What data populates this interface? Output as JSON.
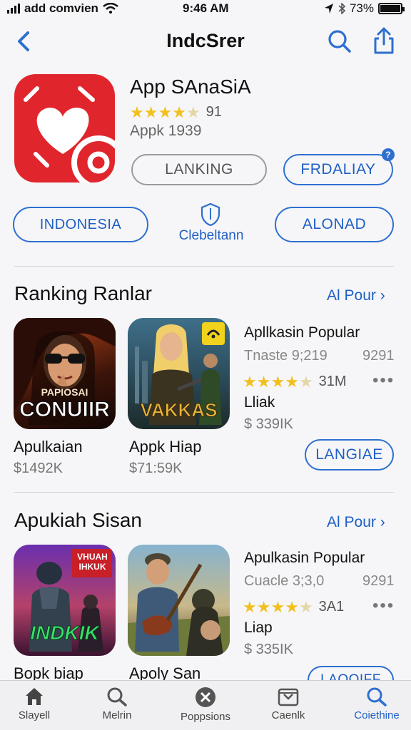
{
  "status_bar": {
    "carrier": "add comvien",
    "time": "9:46 AM",
    "battery": "73%"
  },
  "nav": {
    "title": "IndcSrer"
  },
  "app": {
    "name": "App SAnaSiA",
    "rating_count": "91",
    "rating_stars": 3.5,
    "subtitle": "Appk 1939",
    "buttons": {
      "left": "LANKING",
      "right": "FRDALIAY"
    },
    "badge": "?"
  },
  "row2": {
    "left": "INDONESIA",
    "middle": "Clebeltann",
    "right": "ALONAD"
  },
  "section1": {
    "title": "Ranking Ranlar",
    "see_all": "Al Pour",
    "tiles": [
      {
        "art_top": "PAPIOSAI",
        "art_bottom": "CONUIIR",
        "title": "Apulkaian",
        "price": "$1492K"
      },
      {
        "art_top": "",
        "art_bottom": "VAKKAS",
        "title": "Appk Hiap",
        "price": "$71:59K"
      }
    ],
    "info": {
      "title": "Apllkasin Popular",
      "sub": "Tnaste 9;219",
      "size": "9291",
      "stars": 4.5,
      "count": "31M",
      "name": "Lliak",
      "price": "$ 339IK",
      "button": "LANGIAE"
    }
  },
  "section2": {
    "title": "Apukiah Sisan",
    "see_all": "Al Pour",
    "tiles": [
      {
        "art_top": "VHUAH IHKUK",
        "art_bottom": "INDKIK",
        "title": "Bopk biap",
        "price": ""
      },
      {
        "art_top": "",
        "art_bottom": "",
        "title": "Apoly San",
        "price": ""
      }
    ],
    "info": {
      "title": "Apulkasin Popular",
      "sub": "Cuacle 3;3,0",
      "size": "9291",
      "stars": 4.5,
      "count": "3A1",
      "name": "Liap",
      "price": "$ 335IK",
      "button": "LAQQIFF"
    }
  },
  "tabs": [
    {
      "icon": "house-icon",
      "label": "Slayell"
    },
    {
      "icon": "search-icon",
      "label": "Melrin"
    },
    {
      "icon": "close-circle-icon",
      "label": "Poppsions"
    },
    {
      "icon": "tray-icon",
      "label": "Caenlk"
    },
    {
      "icon": "search-icon",
      "label": "Coiethine"
    }
  ],
  "colors": {
    "accent": "#2e6fd0",
    "app_icon": "#e0262c",
    "star": "#f2c01e"
  }
}
